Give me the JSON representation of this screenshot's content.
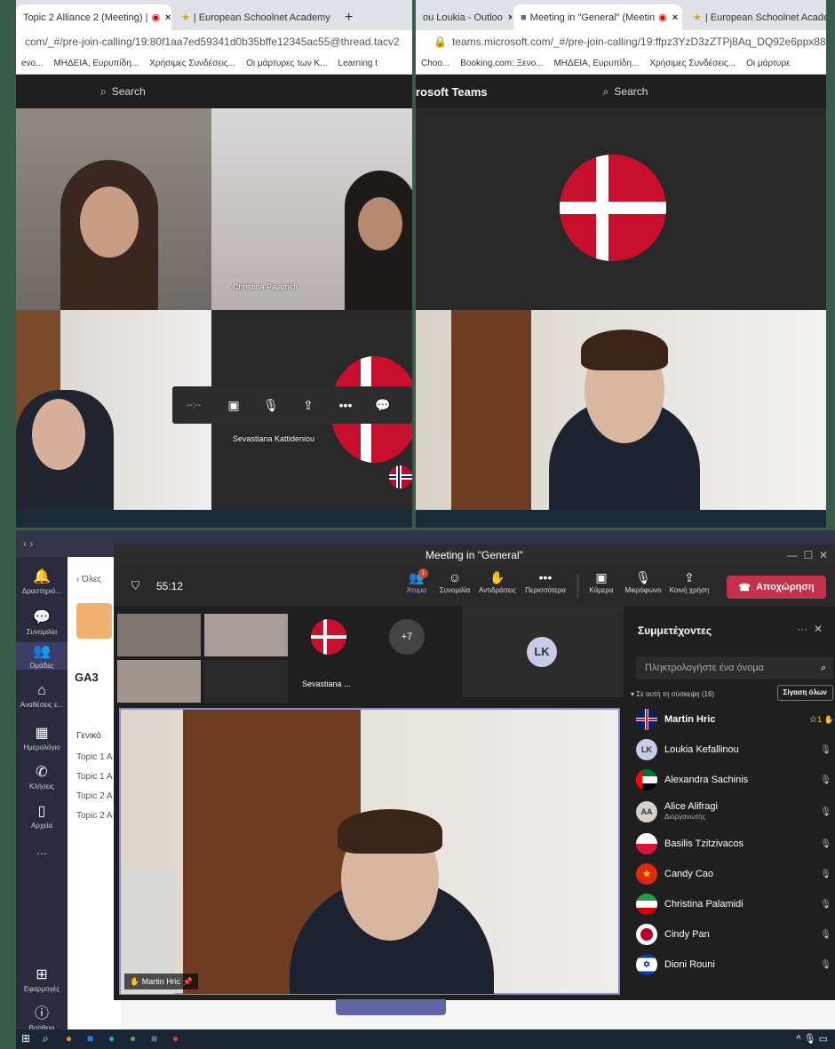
{
  "top_left": {
    "tabs": [
      {
        "label": "Topic 2 Alliance 2 (Meeting) |",
        "close": "×"
      },
      {
        "label": "| European Schoolnet Academy",
        "close": "×"
      },
      {
        "label": "+"
      }
    ],
    "address": "com/_#/pre-join-calling/19:80f1aa7ed59341d0b35bffe12345ac55@thread.tacv2",
    "bookmarks": [
      "evo...",
      "ΜΗΔΕΙΑ, Ευρυπίδη...",
      "Χρήσιμες Συνδέσεις...",
      "Οι μάρτυρες των Κ...",
      "Learning t"
    ],
    "search": "Search",
    "tiles": [
      {
        "name": ""
      },
      {
        "name": "Christina Palamidi"
      },
      {
        "name": ""
      },
      {
        "name": "Sevastiana Kattideniou"
      }
    ],
    "controls": {
      "timer": "--:--"
    }
  },
  "top_right": {
    "tabs": [
      {
        "label": "ou Loukia - Outloo",
        "close": "×"
      },
      {
        "label": "Meeting in \"General\" (Meetin",
        "close": "×"
      },
      {
        "label": "| European Schoolnet Academy"
      }
    ],
    "address": "teams.microsoft.com/_#/pre-join-calling/19:ffpz3YzD3zZTPj8Aq_DQ92e6ppx88gDCbe",
    "bookmarks": [
      "Choo...",
      "Booking.com: Ξενο...",
      "ΜΗΔΕΙΑ, Ευρυπίδη...",
      "Χρήσιμες Συνδέσεις...",
      "Οι μάρτυρε"
    ],
    "app_title": "rosoft Teams",
    "search": "Search"
  },
  "bottom": {
    "sidebar": [
      {
        "label": "Δραστηριό...",
        "icon": "bell-icon"
      },
      {
        "label": "Συνομιλία",
        "icon": "chat-icon"
      },
      {
        "label": "Ομάδες",
        "icon": "teams-icon"
      },
      {
        "label": "Αναθέσεις ε...",
        "icon": "assignments-icon"
      },
      {
        "label": "Ημερολόγιο",
        "icon": "calendar-icon"
      },
      {
        "label": "Κλήσεις",
        "icon": "phone-icon"
      },
      {
        "label": "Αρχεία",
        "icon": "file-icon"
      },
      {
        "label": "...",
        "icon": "more-icon"
      }
    ],
    "sidebar_bottom": [
      {
        "label": "Εφαρμογές",
        "icon": "apps-icon"
      },
      {
        "label": "Βοήθεια",
        "icon": "help-icon"
      }
    ],
    "team": {
      "back": "Όλες",
      "name": "GA3",
      "channels": [
        "Γενικό",
        "Topic 1 A",
        "Topic 1 A",
        "Topic 2 A",
        "Topic 2 A"
      ]
    },
    "meeting": {
      "title": "Meeting in \"General\"",
      "timer": "55:12",
      "toolbar": [
        {
          "label": "Άτομα",
          "icon": "people-icon",
          "badge": "1"
        },
        {
          "label": "Συνομιλία",
          "icon": "chat-icon"
        },
        {
          "label": "Αντιδράσεις",
          "icon": "reactions-icon"
        },
        {
          "label": "Περισσότερα",
          "icon": "more-icon"
        },
        {
          "label": "Κάμερα",
          "icon": "camera-off-icon"
        },
        {
          "label": "Μικρόφωνο",
          "icon": "mic-off-icon"
        },
        {
          "label": "Κοινή χρήση",
          "icon": "share-icon"
        }
      ],
      "leave": "Αποχώρηση",
      "gallery": {
        "sevastiana": "Sevastiana ...",
        "more": "+7",
        "lk": "LK"
      },
      "main_speaker": "Martin Hric"
    },
    "participants": {
      "title": "Συμμετέχοντες",
      "search_placeholder": "Πληκτρολογήστε ένα όνομα",
      "section": "Σε αυτή τη σύσκεψη (16)",
      "mute_all": "Σίγαση όλων",
      "list": [
        {
          "name": "Martin Hric",
          "flag": "uk",
          "hand": "1"
        },
        {
          "name": "Loukia Kefallinou",
          "initials": "LK"
        },
        {
          "name": "Alexandra Sachinis",
          "flag": "uae"
        },
        {
          "name": "Alice Alifragi",
          "initials": "AA",
          "role": "Διοργανωτής"
        },
        {
          "name": "Basilis Tzitzivacos",
          "flag": "poland"
        },
        {
          "name": "Candy Cao",
          "flag": "china"
        },
        {
          "name": "Christina Palamidi",
          "flag": "iran"
        },
        {
          "name": "Cindy Pan",
          "flag": "japan"
        },
        {
          "name": "Dioni Rouni",
          "flag": "israel"
        }
      ]
    }
  },
  "colors": {
    "teams_dark": "#1f1f1f",
    "leave_red": "#c4314b",
    "rail": "#2b2b40",
    "accent": "#6264a7"
  }
}
